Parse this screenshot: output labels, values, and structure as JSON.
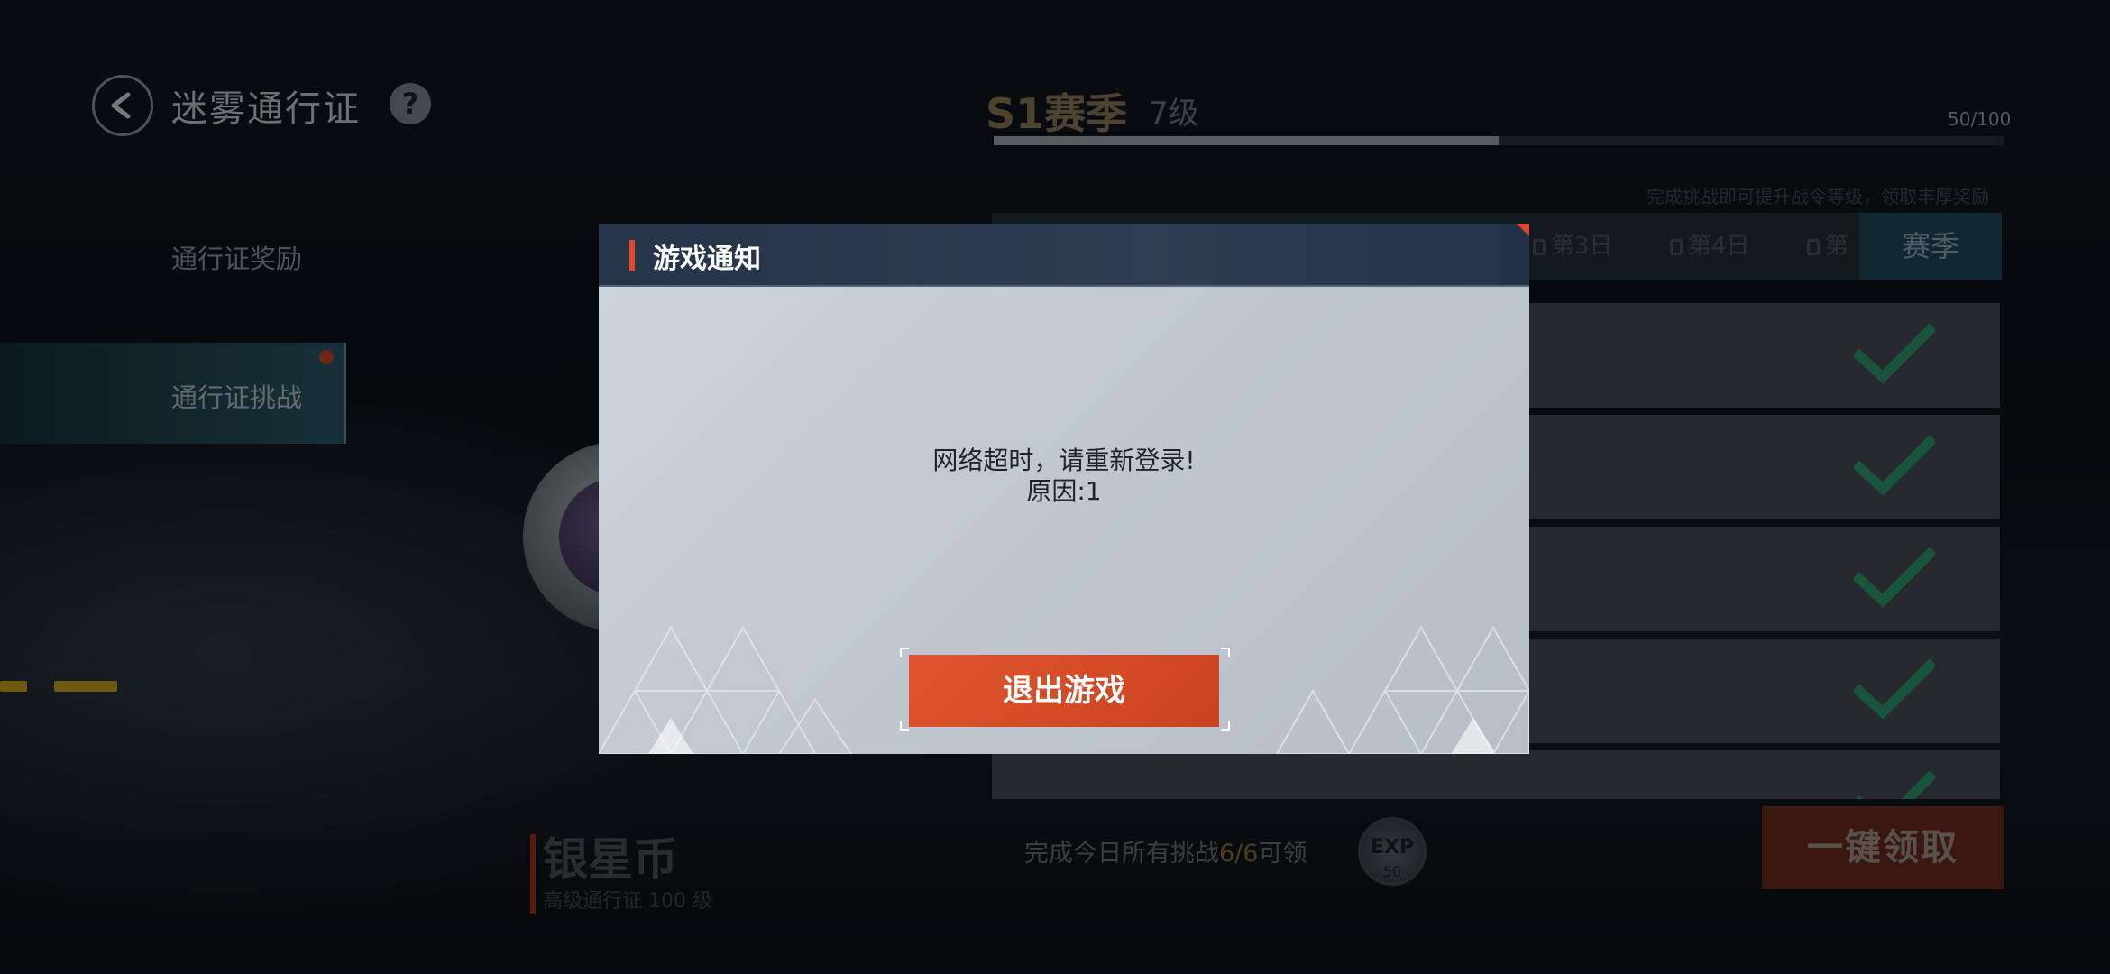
{
  "header": {
    "title": "迷雾通行证",
    "help_symbol": "?"
  },
  "nav": {
    "items": [
      {
        "label": "通行证奖励",
        "active": false
      },
      {
        "label": "通行证挑战",
        "active": true,
        "has_badge": true
      }
    ]
  },
  "season": {
    "title": "S1赛季",
    "level": "7级",
    "progress_text": "50/100",
    "progress": 0.5,
    "hint": "完成挑战即可提升战令等级，领取丰厚奖励"
  },
  "tabs": {
    "day3": "第3日",
    "day4": "第4日",
    "day5_partial": "第",
    "season": "赛季"
  },
  "bottom": {
    "coin_title": "银星币",
    "coin_sub": "高级通行证 100 级",
    "daily_text": "完成今日所有挑战",
    "daily_count": "6/6",
    "daily_suffix": "可领",
    "exp_label": "EXP",
    "exp_value": "50",
    "claim_button": "一键领取"
  },
  "dialog": {
    "title": "游戏通知",
    "message_line1": "网络超时，请重新登录!",
    "message_line2": "原因:1",
    "exit_button": "退出游戏"
  },
  "colors": {
    "accent": "#e5452b",
    "check": "#2f9a6f"
  }
}
